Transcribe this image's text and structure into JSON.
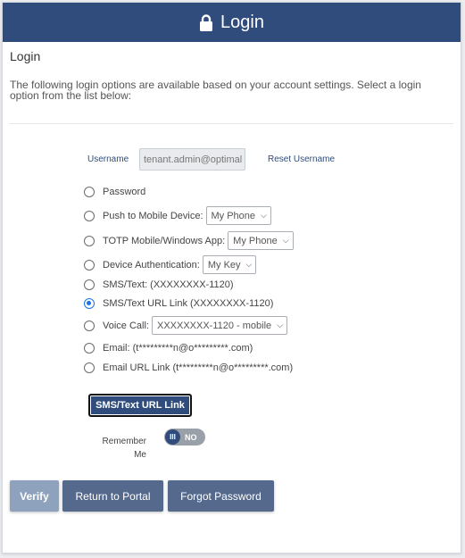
{
  "header": {
    "title": "Login",
    "icon": "lock-icon"
  },
  "section_title": "Login",
  "intro_text": "The following login options are available based on your account settings. Select a login option from the list below:",
  "username": {
    "label": "Username",
    "value": "tenant.admin@optimal",
    "reset_label": "Reset Username"
  },
  "options": [
    {
      "label": "Password",
      "selected": false
    },
    {
      "label": "Push to Mobile Device:",
      "select_value": "My Phone",
      "selected": false
    },
    {
      "label": "TOTP Mobile/Windows App:",
      "select_value": "My Phone",
      "selected": false
    },
    {
      "label": "Device Authentication:",
      "select_value": "My Key",
      "selected": false
    },
    {
      "label": "SMS/Text: (XXXXXXXX-1120)",
      "selected": false
    },
    {
      "label": "SMS/Text URL Link (XXXXXXXX-1120)",
      "selected": true
    },
    {
      "label": "Voice Call:",
      "select_value": "XXXXXXXX-1120 - mobile",
      "selected": false
    },
    {
      "label": "Email: (t*********n@o*********.com)",
      "selected": false
    },
    {
      "label": "Email URL Link (t*********n@o*********.com)",
      "selected": false
    }
  ],
  "action_button_label": "SMS/Text URL Link",
  "remember_me": {
    "label": "Remember Me",
    "toggle_text": "NO",
    "knob_text": "III",
    "on": false
  },
  "buttons": {
    "verify": "Verify",
    "return_portal": "Return to Portal",
    "forgot_password": "Forgot Password"
  },
  "colors": {
    "header_bg": "#2f4c7c",
    "button_bg": "#55698d",
    "verify_disabled_bg": "#8fa2bd",
    "radio_selected": "#1a73e8"
  }
}
